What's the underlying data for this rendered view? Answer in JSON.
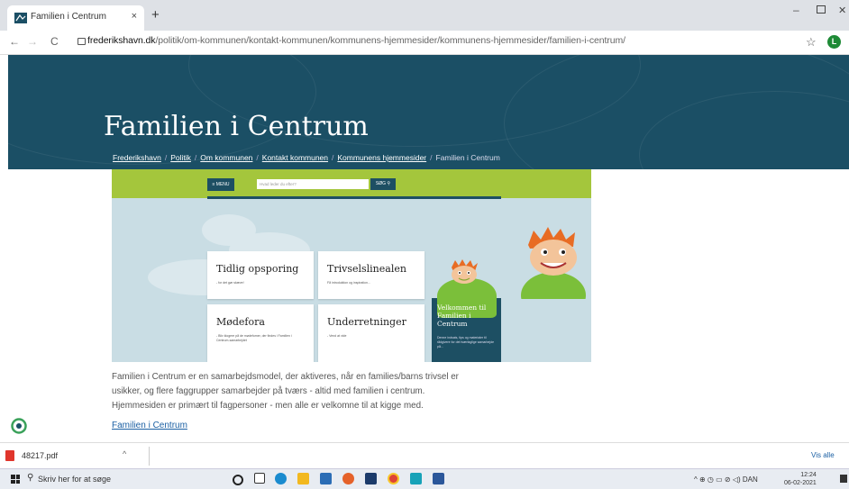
{
  "browser": {
    "tab_title": "Familien i Centrum",
    "tab_close": "×",
    "new_tab": "+",
    "url_domain": "frederikshavn.dk",
    "url_path": "/politik/om-kommunen/kontakt-kommunen/kommunens-hjemmesider/kommunens-hjemmesider/familien-i-centrum/",
    "profile_initial": "L",
    "back": "←",
    "forward": "→",
    "reload": "C",
    "star": "☆",
    "minimize": "–",
    "close": "✕"
  },
  "hero": {
    "title": "Familien i Centrum",
    "breadcrumbs": [
      "Frederikshavn",
      "Politik",
      "Om kommunen",
      "Kontakt kommunen",
      "Kommunens hjemmesider"
    ],
    "current": "Familien i Centrum",
    "sep": "/"
  },
  "banner": {
    "menu_label": "≡ MENU",
    "search_placeholder": "Hvad leder du efter?",
    "search_button": "SØG ⚲",
    "cards": [
      {
        "title": "Tidlig opsporing",
        "sub": "- for det gør skæve!"
      },
      {
        "title": "Trivselslinealen",
        "sub": "Få introduktion og inspiration..."
      },
      {
        "title": "Mødefora",
        "sub": "- Bliv klogere på de mødefomer, der findes i Familien i Centrum-samarbejdet"
      },
      {
        "title": "Underretninger",
        "sub": "- Vend at vide"
      }
    ],
    "welcome_title": "Velkommen til Familien i Centrum",
    "welcome_sub": "Denne indsats, tips og materialer til rådgivere for det tværfaglige samarbejde på..."
  },
  "content": {
    "paragraph": "Familien i Centrum er en samarbejdsmodel, der aktiveres, når en families/barns trivsel er usikker, og flere faggrupper samarbejder på tværs - altid med familien i centrum. Hjemmesiden er primært til fagpersoner - men alle er velkomne til at kigge med.",
    "link": "Familien i Centrum"
  },
  "downloads": {
    "file": "48217.pdf",
    "chevron": "^",
    "show_all": "Vis alle"
  },
  "taskbar": {
    "search_placeholder": "Skriv her for at søge",
    "tray": "^  ⊕  ◷  ▭  ⊘  ◁)  DAN",
    "time": "12:24",
    "date": "06-02-2021"
  },
  "colors": {
    "hero": "#1b4f65",
    "green": "#a4c63c",
    "link": "#1a5fa3"
  }
}
